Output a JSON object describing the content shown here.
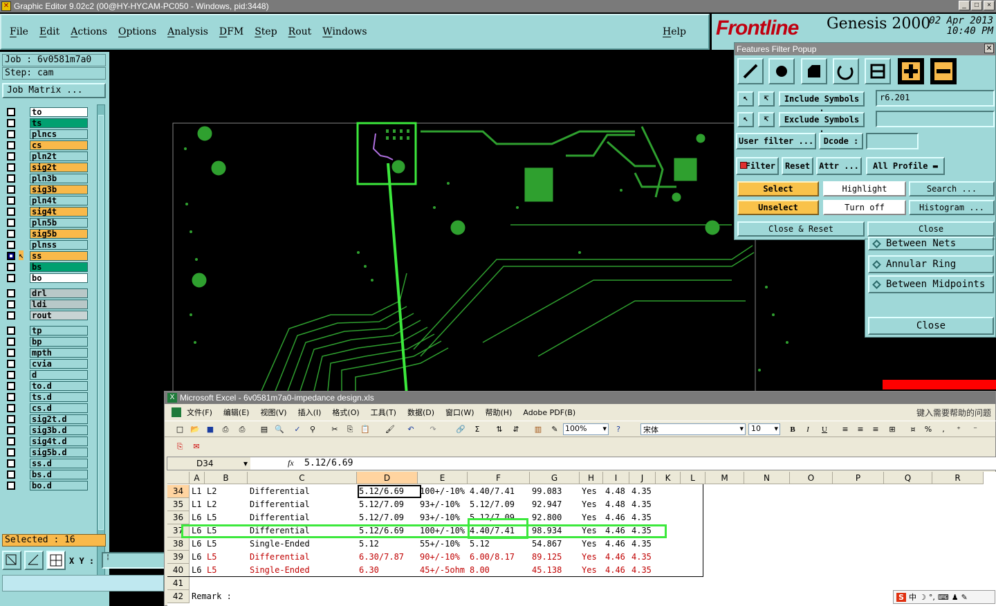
{
  "window": {
    "title": "Graphic Editor 9.02c2 (00@HY-HYCAM-PC050 - Windows, pid:3448)"
  },
  "menu": {
    "items": [
      "File",
      "Edit",
      "Actions",
      "Options",
      "Analysis",
      "DFM",
      "Step",
      "Rout",
      "Windows"
    ],
    "help": "Help"
  },
  "branding": {
    "logo": "Frontline",
    "product": "Genesis 2000",
    "date": "02 Apr 2013",
    "time": "10:40 PM"
  },
  "job": {
    "job_label": "Job : 6v0581m7a0",
    "step_label": "Step: cam",
    "matrix_button": "Job Matrix ..."
  },
  "layers": [
    {
      "name": "to",
      "style": "white"
    },
    {
      "name": "ts",
      "style": "green"
    },
    {
      "name": "plncs",
      "style": "plain"
    },
    {
      "name": "cs",
      "style": "orange"
    },
    {
      "name": "pln2t",
      "style": "plain"
    },
    {
      "name": "sig2t",
      "style": "orange"
    },
    {
      "name": "pln3b",
      "style": "plain"
    },
    {
      "name": "sig3b",
      "style": "orange"
    },
    {
      "name": "pln4t",
      "style": "plain"
    },
    {
      "name": "sig4t",
      "style": "orange"
    },
    {
      "name": "pln5b",
      "style": "plain"
    },
    {
      "name": "sig5b",
      "style": "orange"
    },
    {
      "name": "plnss",
      "style": "plain"
    },
    {
      "name": "ss",
      "style": "orange"
    },
    {
      "name": "bs",
      "style": "green"
    },
    {
      "name": "bo",
      "style": "white"
    },
    {
      "name": "drl",
      "style": "grey"
    },
    {
      "name": "ldi",
      "style": "grey"
    },
    {
      "name": "rout",
      "style": "drill"
    },
    {
      "name": "tp",
      "style": "plain"
    },
    {
      "name": "bp",
      "style": "plain"
    },
    {
      "name": "mpth",
      "style": "plain"
    },
    {
      "name": "cvia",
      "style": "plain"
    },
    {
      "name": "d",
      "style": "plain"
    },
    {
      "name": "to.d",
      "style": "plain"
    },
    {
      "name": "ts.d",
      "style": "plain"
    },
    {
      "name": "cs.d",
      "style": "plain"
    },
    {
      "name": "sig2t.d",
      "style": "plain"
    },
    {
      "name": "sig3b.d",
      "style": "plain"
    },
    {
      "name": "sig4t.d",
      "style": "plain"
    },
    {
      "name": "sig5b.d",
      "style": "plain"
    },
    {
      "name": "ss.d",
      "style": "plain"
    },
    {
      "name": "bs.d",
      "style": "plain"
    },
    {
      "name": "bo.d",
      "style": "plain"
    }
  ],
  "selected_label": "Selected : 16",
  "xy_label": "X Y :",
  "filter_popup": {
    "title": "Features Filter Popup",
    "include_label": "Include Symbols :",
    "include_value": "r6.201",
    "exclude_label": "Exclude Symbols :",
    "exclude_value": "",
    "user_filter": "User filter ...",
    "dcode": "Dcode :",
    "dcode_value": "",
    "filter": "Filter",
    "reset": "Reset",
    "attr": "Attr ...",
    "profile": "All Profile",
    "select": "Select",
    "highlight": "Highlight",
    "search": "Search ...",
    "unselect": "Unselect",
    "turn_off": "Turn off",
    "histogram": "Histogram ...",
    "close_reset": "Close & Reset",
    "close": "Close"
  },
  "secondary": {
    "items": [
      "Between Nets",
      "Annular Ring",
      "Between Midpoints"
    ],
    "close": "Close"
  },
  "excel": {
    "title": "Microsoft Excel - 6v0581m7a0-impedance design.xls",
    "menu": [
      "文件(F)",
      "编辑(E)",
      "视图(V)",
      "插入(I)",
      "格式(O)",
      "工具(T)",
      "数据(D)",
      "窗口(W)",
      "帮助(H)",
      "Adobe PDF(B)"
    ],
    "help_prompt": "键入需要帮助的问题",
    "zoom": "100%",
    "font": "宋体",
    "size": "10",
    "name_box": "D34",
    "fx": "fx",
    "formula": "5.12/6.69",
    "columns": [
      "A",
      "B",
      "C",
      "D",
      "E",
      "F",
      "G",
      "H",
      "I",
      "J",
      "K",
      "L",
      "M",
      "N",
      "O",
      "P",
      "Q",
      "R"
    ],
    "rows": [
      {
        "num": "34",
        "cells": [
          "L1",
          "L2",
          "Differential",
          "5.12/6.69",
          "100+/-10%",
          "4.40/7.41",
          "99.083",
          "Yes",
          "4.48",
          "4.35"
        ],
        "red": false
      },
      {
        "num": "35",
        "cells": [
          "L1",
          "L2",
          "Differential",
          "5.12/7.09",
          "93+/-10%",
          "5.12/7.09",
          "92.947",
          "Yes",
          "4.48",
          "4.35"
        ],
        "red": false
      },
      {
        "num": "36",
        "cells": [
          "L6",
          "L5",
          "Differential",
          "5.12/7.09",
          "93+/-10%",
          "5.12/7.09",
          "92.800",
          "Yes",
          "4.46",
          "4.35"
        ],
        "red": false
      },
      {
        "num": "37",
        "cells": [
          "L6",
          "L5",
          "Differential",
          "5.12/6.69",
          "100+/-10%",
          "4.40/7.41",
          "98.934",
          "Yes",
          "4.46",
          "4.35"
        ],
        "red": false
      },
      {
        "num": "38",
        "cells": [
          "L6",
          "L5",
          "Single-Ended",
          "5.12",
          "55+/-10%",
          "5.12",
          "54.867",
          "Yes",
          "4.46",
          "4.35"
        ],
        "red": false
      },
      {
        "num": "39",
        "cells": [
          "L6",
          "L5",
          "Differential",
          "6.30/7.87",
          "90+/-10%",
          "6.00/8.17",
          "89.125",
          "Yes",
          "4.46",
          "4.35"
        ],
        "red": true
      },
      {
        "num": "40",
        "cells": [
          "L6",
          "L5",
          "Single-Ended",
          "6.30",
          "45+/-5ohm",
          "8.00",
          "45.138",
          "Yes",
          "4.46",
          "4.35"
        ],
        "red": true
      },
      {
        "num": "41",
        "cells": [
          "",
          "",
          "",
          "",
          "",
          "",
          "",
          "",
          "",
          ""
        ],
        "red": false
      },
      {
        "num": "42",
        "cells": [
          "Remark :",
          "",
          "",
          "",
          "",
          "",
          "",
          "",
          "",
          ""
        ],
        "red": false
      }
    ]
  },
  "colors": {
    "panel": "#9fd8d8",
    "orange": "#f9b94a",
    "trace": "#2fa02f",
    "highlight": "#3ce83c"
  }
}
